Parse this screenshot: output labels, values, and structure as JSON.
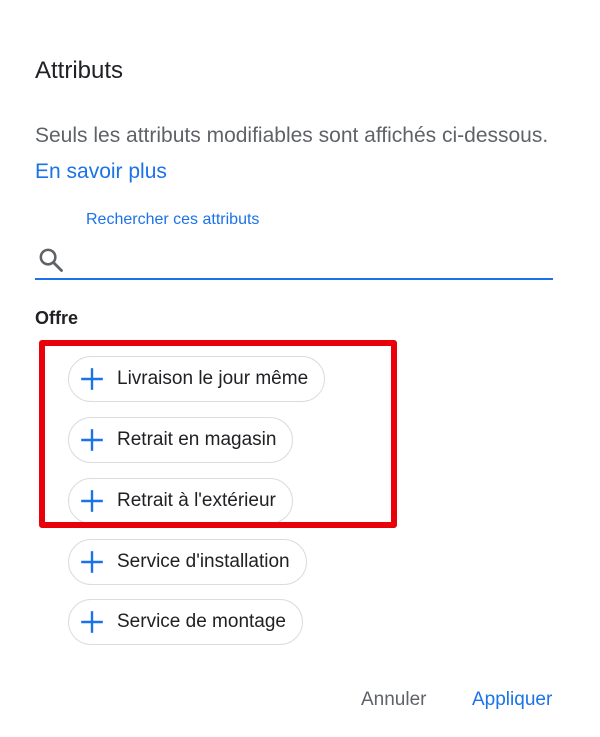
{
  "dialog": {
    "title": "Attributs",
    "description": "Seuls les attributs modifiables sont affichés ci-dessous.",
    "learn_more_link": "En savoir plus",
    "search": {
      "label": "Rechercher ces attributs",
      "value": "",
      "icon": "search-icon"
    },
    "section_title": "Offre",
    "chips": [
      {
        "label": "Livraison le jour même",
        "icon": "plus-icon"
      },
      {
        "label": "Retrait en magasin",
        "icon": "plus-icon"
      },
      {
        "label": "Retrait à l'extérieur",
        "icon": "plus-icon"
      },
      {
        "label": "Service d'installation",
        "icon": "plus-icon"
      },
      {
        "label": "Service de montage",
        "icon": "plus-icon"
      }
    ],
    "buttons": {
      "cancel": "Annuler",
      "apply": "Appliquer"
    }
  },
  "colors": {
    "accent": "#1a73e8",
    "highlight": "#e8000b",
    "secondary_text": "#5f6368",
    "chip_border": "#dadce0"
  }
}
